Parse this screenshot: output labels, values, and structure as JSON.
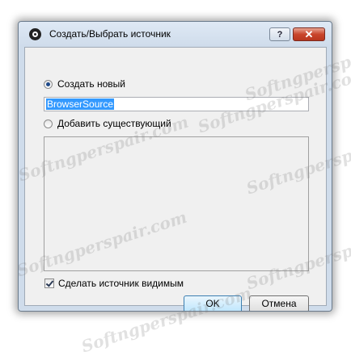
{
  "window": {
    "title": "Создать/Выбрать источник",
    "help_label": "?",
    "close_label": "✕"
  },
  "form": {
    "create_new_label": "Создать новый",
    "create_new_checked": true,
    "source_name_value": "BrowserSource",
    "add_existing_label": "Добавить существующий",
    "add_existing_checked": false,
    "existing_sources": [],
    "make_visible_label": "Сделать источник видимым",
    "make_visible_checked": true
  },
  "buttons": {
    "ok_label": "OK",
    "cancel_label": "Отмена"
  },
  "watermark": {
    "text": "Softngperspair.com"
  },
  "colors": {
    "selection": "#3399ff",
    "close_button": "#c9452b",
    "titlebar": "#dfe9f5"
  }
}
